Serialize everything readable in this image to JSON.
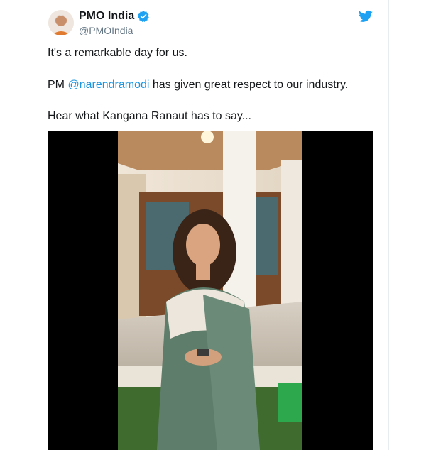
{
  "account": {
    "display_name": "PMO India",
    "handle": "@PMOIndia"
  },
  "tweet": {
    "line1": "It's a remarkable day for us.",
    "line2_prefix": "PM ",
    "line2_mention": "@narendramodi",
    "line2_suffix": " has given great respect to our industry.",
    "line3": "Hear what Kangana Ranaut has to say..."
  },
  "icons": {
    "verified": "verified-badge-icon",
    "brand": "twitter-bird-icon"
  },
  "colors": {
    "link": "#1b95e0",
    "verified": "#1da1f2",
    "text": "#14171a",
    "muted": "#657786"
  }
}
